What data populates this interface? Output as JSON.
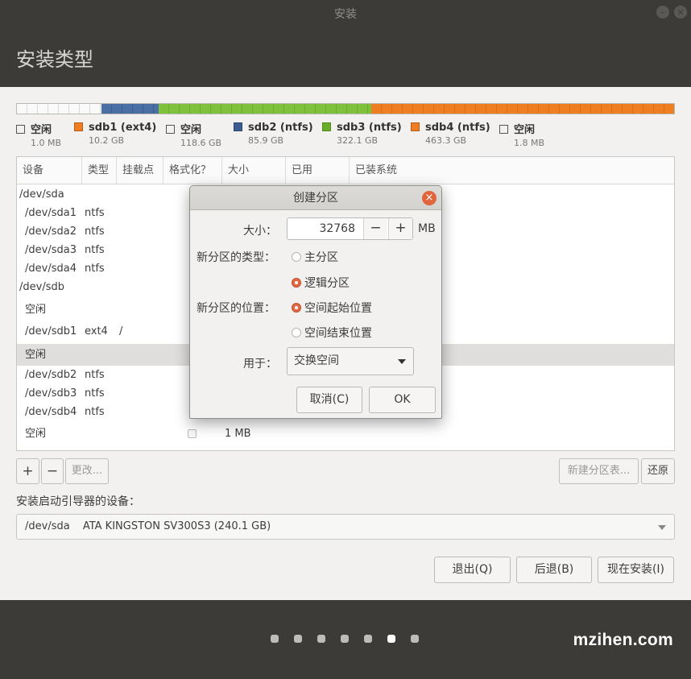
{
  "window": {
    "title": "安装"
  },
  "header": {
    "title": "安装类型"
  },
  "legend": [
    {
      "name": "空闲",
      "size": "1.0 MB",
      "color": "#ffffff"
    },
    {
      "name": "sdb1 (ext4)",
      "size": "10.2 GB",
      "color": "#ef7d22"
    },
    {
      "name": "空闲",
      "size": "118.6 GB",
      "color": "#ffffff"
    },
    {
      "name": "sdb2 (ntfs)",
      "size": "85.9 GB",
      "color": "#3b5d8f"
    },
    {
      "name": "sdb3 (ntfs)",
      "size": "322.1 GB",
      "color": "#6aad2b"
    },
    {
      "name": "sdb4 (ntfs)",
      "size": "463.3 GB",
      "color": "#ef7d22"
    },
    {
      "name": "空闲",
      "size": "1.8 MB",
      "color": "#ffffff"
    }
  ],
  "table": {
    "headers": [
      "设备",
      "类型",
      "挂载点",
      "格式化？",
      "大小",
      "已用",
      "已装系统"
    ],
    "rows": [
      {
        "device": "/dev/sda",
        "type": "",
        "mount": "",
        "size": ""
      },
      {
        "device": "/dev/sda1",
        "type": "ntfs",
        "mount": "",
        "size": ""
      },
      {
        "device": "/dev/sda2",
        "type": "ntfs",
        "mount": "",
        "size": ""
      },
      {
        "device": "/dev/sda3",
        "type": "ntfs",
        "mount": "",
        "size": ""
      },
      {
        "device": "/dev/sda4",
        "type": "ntfs",
        "mount": "",
        "size": ""
      },
      {
        "device": "/dev/sdb",
        "type": "",
        "mount": "",
        "size": ""
      },
      {
        "device": "空闲",
        "type": "",
        "mount": "",
        "size": ""
      },
      {
        "device": "/dev/sdb1",
        "type": "ext4",
        "mount": "/",
        "size": ""
      },
      {
        "device": "空闲",
        "type": "",
        "mount": "",
        "size": ""
      },
      {
        "device": "/dev/sdb2",
        "type": "ntfs",
        "mount": "",
        "size": ""
      },
      {
        "device": "/dev/sdb3",
        "type": "ntfs",
        "mount": "",
        "size": ""
      },
      {
        "device": "/dev/sdb4",
        "type": "ntfs",
        "mount": "",
        "size": ""
      },
      {
        "device": "空闲",
        "type": "",
        "mount": "",
        "size": "1 MB"
      }
    ]
  },
  "toolbar": {
    "add": "+",
    "remove": "−",
    "change": "更改...",
    "new_table": "新建分区表...",
    "revert": "还原"
  },
  "boot": {
    "label": "安装启动引导器的设备：",
    "device": "/dev/sda",
    "model": "ATA KINGSTON SV300S3 (240.1 GB)"
  },
  "footer_buttons": {
    "quit": "退出(Q)",
    "back": "后退(B)",
    "install": "现在安装(I)"
  },
  "progress_dots": {
    "count": 7,
    "active": 6
  },
  "watermark": "mzihen.com",
  "dialog": {
    "title": "创建分区",
    "size_label": "大小：",
    "size_value": "32768",
    "minus": "−",
    "plus": "+",
    "unit": "MB",
    "type_label": "新分区的类型：",
    "type_primary": "主分区",
    "type_logical": "逻辑分区",
    "type_selected": "logical",
    "location_label": "新分区的位置：",
    "location_start": "空间起始位置",
    "location_end": "空间结束位置",
    "location_selected": "start",
    "use_label": "用于：",
    "use_value": "交换空间",
    "cancel": "取消(C)",
    "ok": "OK"
  }
}
